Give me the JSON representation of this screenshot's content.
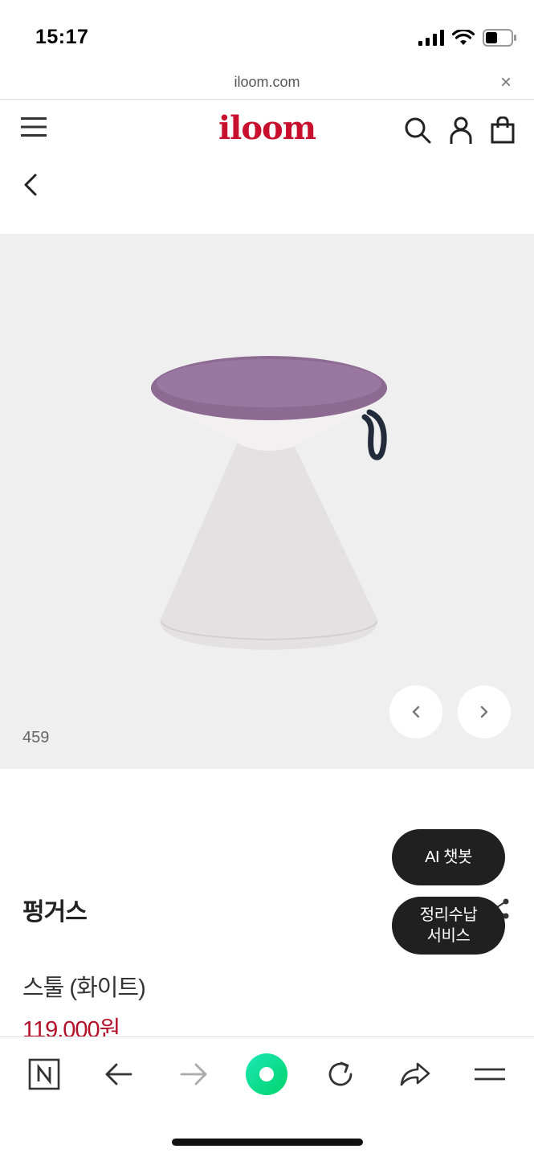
{
  "status_bar": {
    "time": "15:17"
  },
  "browser": {
    "url": "iloom.com",
    "close_label": "×"
  },
  "site": {
    "logo": "iloom"
  },
  "gallery": {
    "image_counter": "459",
    "prev_label": "‹",
    "next_label": "›"
  },
  "product": {
    "name": "펑거스",
    "subtitle": "스툴 (화이트)",
    "price": "119,000원"
  },
  "floating": {
    "ai_chatbot": "AI 챗봇",
    "storage_service_line1": "정리수납",
    "storage_service_line2": "서비스"
  },
  "colors": {
    "brand": "#c8102e",
    "price": "#b5102a",
    "gallery_bg": "#efefef",
    "floating_bg": "#202020",
    "green_button": "#03c75a"
  }
}
